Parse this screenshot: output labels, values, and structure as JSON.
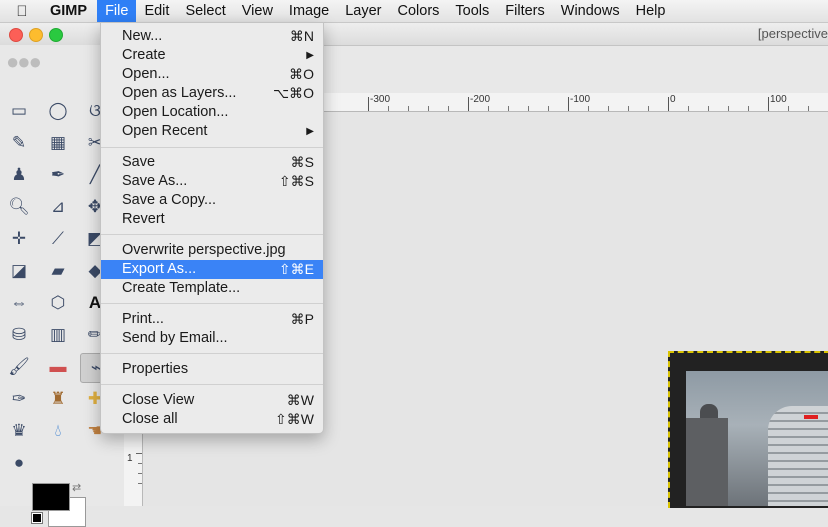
{
  "menubar": {
    "app_name": "GIMP",
    "items": [
      "File",
      "Edit",
      "Select",
      "View",
      "Image",
      "Layer",
      "Colors",
      "Tools",
      "Filters",
      "Windows",
      "Help"
    ]
  },
  "window": {
    "title": "[perspective"
  },
  "ruler": {
    "labels": [
      "-300",
      "-200",
      "-100",
      "0",
      "100"
    ],
    "vlabel": "1"
  },
  "file_menu": {
    "items": [
      {
        "label": "New...",
        "shortcut": "⌘N"
      },
      {
        "label": "Create",
        "shortcut": "▶"
      },
      {
        "label": "Open...",
        "shortcut": "⌘O"
      },
      {
        "label": "Open as Layers...",
        "shortcut": "⌥⌘O"
      },
      {
        "label": "Open Location...",
        "shortcut": ""
      },
      {
        "label": "Open Recent",
        "shortcut": "▶"
      },
      {
        "label": "Save",
        "shortcut": "⌘S"
      },
      {
        "label": "Save As...",
        "shortcut": "⇧⌘S"
      },
      {
        "label": "Save a Copy...",
        "shortcut": ""
      },
      {
        "label": "Revert",
        "shortcut": ""
      },
      {
        "label": "Overwrite perspective.jpg",
        "shortcut": ""
      },
      {
        "label": "Export As...",
        "shortcut": "⇧⌘E"
      },
      {
        "label": "Create Template...",
        "shortcut": ""
      },
      {
        "label": "Print...",
        "shortcut": "⌘P"
      },
      {
        "label": "Send by Email...",
        "shortcut": ""
      },
      {
        "label": "Properties",
        "shortcut": ""
      },
      {
        "label": "Close View",
        "shortcut": "⌘W"
      },
      {
        "label": "Close all",
        "shortcut": "⇧⌘W"
      }
    ],
    "highlighted": "Export As..."
  },
  "toolbox": {
    "tools": [
      "rect-select",
      "ellipse-select",
      "free-select",
      "fuzzy-select",
      "color-select",
      "scissors",
      "foreground-select",
      "paths",
      "color-picker",
      "zoom",
      "measure",
      "move",
      "align",
      "crop",
      "rotate",
      "scale",
      "shear",
      "perspective",
      "flip",
      "cage",
      "text",
      "bucket-fill",
      "blend",
      "airbrush",
      "paintbrush",
      "eraser",
      "airbrush-selected",
      "ink",
      "clone",
      "heal",
      "perspective-clone",
      "blur",
      "smudge",
      "dodge"
    ]
  },
  "colors": {
    "foreground": "#000000",
    "background": "#ffffff",
    "menu_highlight": "#3a83f6"
  }
}
